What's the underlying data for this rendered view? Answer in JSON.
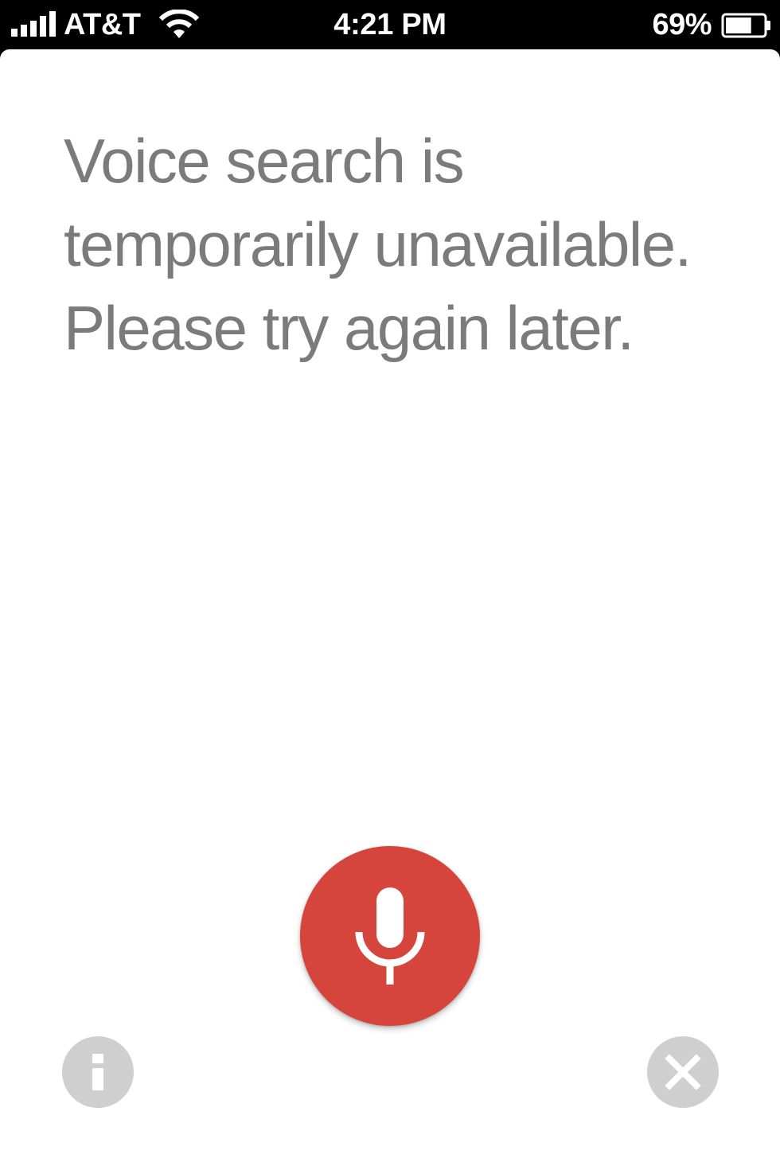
{
  "status_bar": {
    "carrier": "AT&T",
    "time": "4:21 PM",
    "battery_percent": "69%",
    "battery_level": 0.69,
    "signal_icon": "signal-bars-icon",
    "wifi_icon": "wifi-icon",
    "battery_icon": "battery-icon"
  },
  "voice_search": {
    "message_lines": [
      "Voice search is",
      "temporarily unavailable.",
      "Please try again later."
    ],
    "mic_icon": "microphone-icon",
    "info_icon": "info-icon",
    "close_icon": "close-icon"
  },
  "colors": {
    "accent_red": "#d5453b",
    "message_text": "#7b7b7b",
    "secondary_button": "#cfcfcf",
    "background": "#ffffff"
  }
}
